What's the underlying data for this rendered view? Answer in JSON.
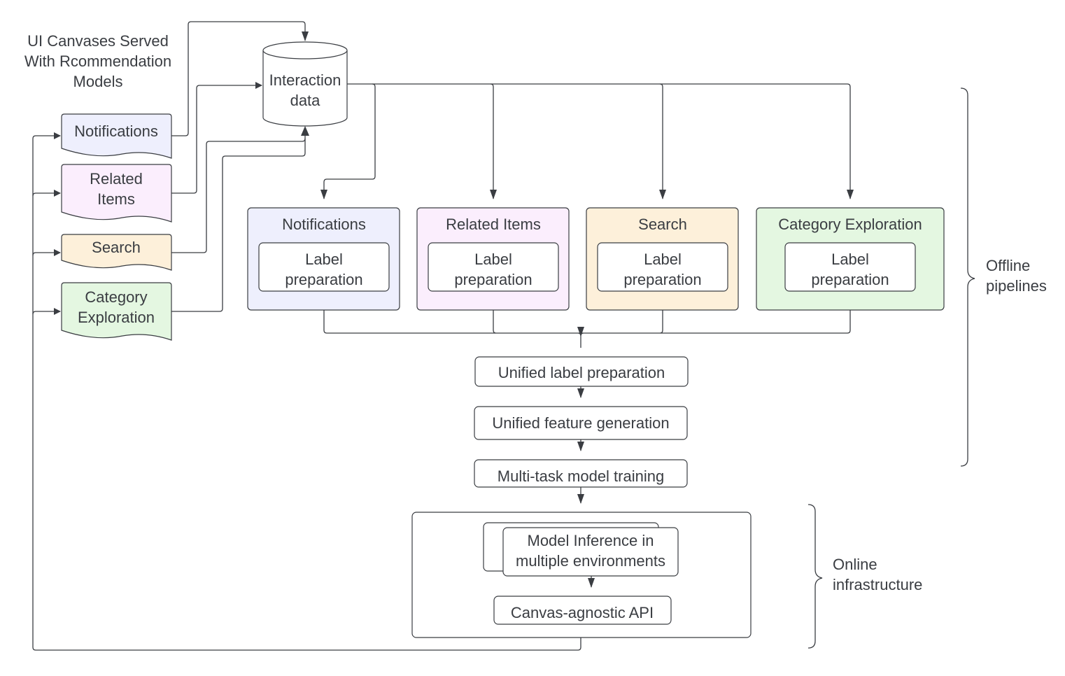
{
  "title_note": [
    "UI Canvases Served",
    "With Rcommendation",
    "Models"
  ],
  "interaction_data": [
    "Interaction",
    "data"
  ],
  "canvases": [
    {
      "lines": [
        "Notifications"
      ],
      "color": "#eeeffd"
    },
    {
      "lines": [
        "Related",
        "Items"
      ],
      "color": "#fbeefd"
    },
    {
      "lines": [
        "Search"
      ],
      "color": "#fdf0da"
    },
    {
      "lines": [
        "Category",
        "Exploration"
      ],
      "color": "#e4f7e1"
    }
  ],
  "pipelines": [
    {
      "title": "Notifications",
      "inner": [
        "Label",
        "preparation"
      ],
      "color": "#eeeffd"
    },
    {
      "title": "Related Items",
      "inner": [
        "Label",
        "preparation"
      ],
      "color": "#fbeefd"
    },
    {
      "title": "Search",
      "inner": [
        "Label",
        "preparation"
      ],
      "color": "#fdf0da"
    },
    {
      "title": "Category Exploration",
      "inner": [
        "Label",
        "preparation"
      ],
      "color": "#e4f7e1"
    }
  ],
  "steps": [
    "Unified label preparation",
    "Unified feature generation",
    "Multi-task model training"
  ],
  "online": {
    "inference": [
      "Model Inference in",
      "multiple environments"
    ],
    "api": "Canvas-agnostic API"
  },
  "brackets": {
    "offline": [
      "Offline",
      "pipelines"
    ],
    "online": [
      "Online",
      "infrastructure"
    ]
  }
}
